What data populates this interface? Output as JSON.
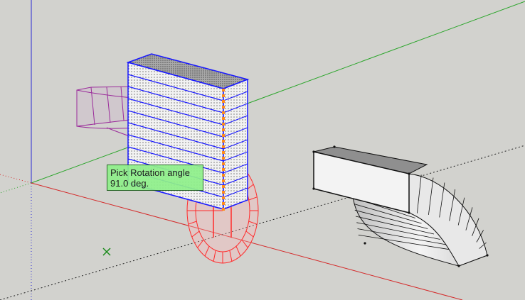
{
  "tooltip": {
    "line1": "Pick Rotation angle",
    "line2": "91.0 deg."
  },
  "colors": {
    "background": "#d2d2ce",
    "axis_red": "#d42a2a",
    "axis_green": "#2aa52a",
    "axis_blue": "#2a2ad4",
    "selection": "#1a1aff",
    "ghost": "#9a2a9a",
    "protractor": "#ff2a2a",
    "tooltip_bg": "#8ff08a",
    "rotation_axis": "#ff8a1a"
  },
  "icons": {
    "origin_marker": "green-x-icon"
  }
}
